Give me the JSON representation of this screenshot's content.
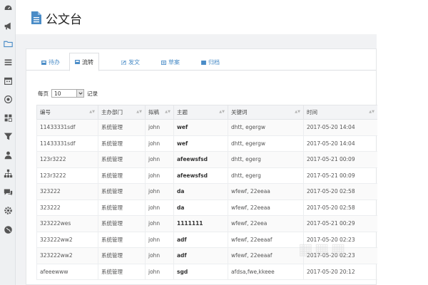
{
  "page": {
    "title": "公文台"
  },
  "sidebar": {
    "items": [
      {
        "icon": "dashboard-icon"
      },
      {
        "icon": "megaphone-icon"
      },
      {
        "icon": "folder-icon"
      },
      {
        "icon": "list-icon"
      },
      {
        "icon": "calendar-icon"
      },
      {
        "icon": "target-icon"
      },
      {
        "icon": "grid-icon"
      },
      {
        "icon": "filter-icon"
      },
      {
        "icon": "user-icon"
      },
      {
        "icon": "sitemap-icon"
      },
      {
        "icon": "chat-icon"
      },
      {
        "icon": "gear-icon"
      },
      {
        "icon": "globe-icon"
      }
    ]
  },
  "tabs": [
    {
      "label": "待办",
      "icon": "inbox-icon",
      "active": false
    },
    {
      "label": "流转",
      "icon": "inbox-icon",
      "active": true
    },
    {
      "label": "发文",
      "icon": "pencil-icon",
      "active": false
    },
    {
      "label": "草案",
      "icon": "document-icon",
      "active": false
    },
    {
      "label": "归档",
      "icon": "archive-icon",
      "active": false
    }
  ],
  "pager": {
    "prefix": "每页",
    "value": "10",
    "suffix": "记录"
  },
  "table": {
    "headers": [
      "编号",
      "主办部门",
      "拟稿",
      "主题",
      "关键词",
      "时间"
    ],
    "rows": [
      [
        "11433331sdf",
        "系统管理",
        "john",
        "wef",
        "dhtt, egergw",
        "2017-05-20 14:04"
      ],
      [
        "11433331sdf",
        "系统管理",
        "john",
        "wef",
        "dhtt, egergw",
        "2017-05-20 14:04"
      ],
      [
        "123r3222",
        "系统管理",
        "john",
        "afeewsfsd",
        "dhtt, egerg",
        "2017-05-21 00:09"
      ],
      [
        "123r3222",
        "系统管理",
        "john",
        "afeewsfsd",
        "dhtt, egerg",
        "2017-05-21 00:09"
      ],
      [
        "323222",
        "系统管理",
        "john",
        "da",
        "wfewf, 22eeaa",
        "2017-05-20 02:58"
      ],
      [
        "323222",
        "系统管理",
        "john",
        "da",
        "wfewf, 22eeaa",
        "2017-05-20 02:58"
      ],
      [
        "323222wes",
        "系统管理",
        "john",
        "1111111",
        "wfewf, 22eea",
        "2017-05-21 00:29"
      ],
      [
        "323222ww2",
        "系统管理",
        "john",
        "adf",
        "wfewf, 22eeaaf",
        "2017-05-20 02:23"
      ],
      [
        "323222ww2",
        "系统管理",
        "john",
        "adf",
        "wfewf, 22eeaaf",
        "2017-05-20 02:23"
      ],
      [
        "afeeewww",
        "系统管理",
        "john",
        "sgd",
        "afdsa,fwe,kkeee",
        "2017-05-20 20:12"
      ]
    ]
  },
  "colors": {
    "accent": "#4a8cc7",
    "sidebar_bg": "#eef0f2",
    "content_bg": "#f1f2f4"
  }
}
